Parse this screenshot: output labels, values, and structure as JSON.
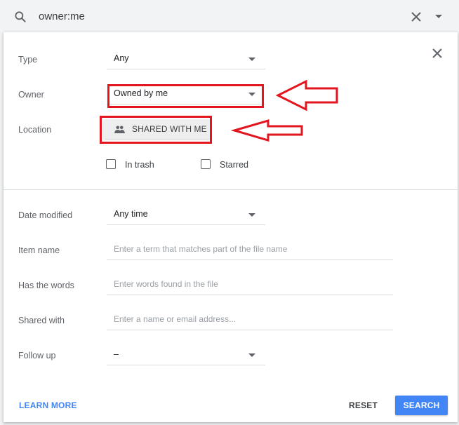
{
  "search": {
    "query": "owner:me"
  },
  "form": {
    "type": {
      "label": "Type",
      "value": "Any"
    },
    "owner": {
      "label": "Owner",
      "value": "Owned by me"
    },
    "location": {
      "label": "Location",
      "button": "SHARED WITH ME",
      "in_trash": "In trash",
      "starred": "Starred"
    },
    "date_modified": {
      "label": "Date modified",
      "value": "Any time"
    },
    "item_name": {
      "label": "Item name",
      "placeholder": "Enter a term that matches part of the file name"
    },
    "has_words": {
      "label": "Has the words",
      "placeholder": "Enter words found in the file"
    },
    "shared_with": {
      "label": "Shared with",
      "placeholder": "Enter a name or email address..."
    },
    "follow_up": {
      "label": "Follow up",
      "value": "–"
    }
  },
  "actions": {
    "learn_more": "LEARN MORE",
    "reset": "RESET",
    "search": "SEARCH"
  },
  "colors": {
    "accent": "#4285f4",
    "annotation": "#e3161f"
  },
  "icons": [
    "search-icon",
    "clear-icon",
    "dropdown-icon",
    "close-icon",
    "people-icon"
  ]
}
